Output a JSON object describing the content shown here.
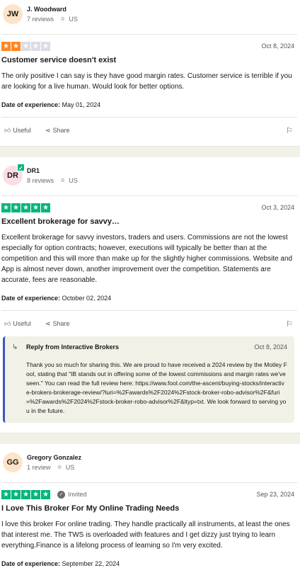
{
  "colors": {
    "star_green": "#00b67a",
    "star_orange": "#ff8622",
    "star_empty": "#dcdce6",
    "reply_accent": "#3c57bc"
  },
  "reviews": [
    {
      "initials": "JW",
      "avatar_bg": "#fde4c8",
      "verified": false,
      "name": "J. Woodward",
      "reviews_count": "7 reviews",
      "country": "US",
      "rating": 2,
      "invited": "",
      "date": "Oct 8, 2024",
      "title": "Customer service doesn't exist",
      "body": "The only positive I can say is they have good margin rates. Customer service is terrible if you are looking for a live human. Would look for better options.",
      "exp_label": "Date of experience:",
      "exp_date": "May 01, 2024",
      "useful": "Useful",
      "share": "Share"
    },
    {
      "initials": "DR",
      "avatar_bg": "#fbdde4",
      "verified": true,
      "name": "DR1",
      "reviews_count": "8 reviews",
      "country": "US",
      "rating": 5,
      "invited": "",
      "date": "Oct 3, 2024",
      "title": "Excellent brokerage for savvy…",
      "body": "Excellent brokerage for savvy investors, traders and users. Commissions are not the lowest especially for option contracts; however, executions will typically be better than at the competition and this will more than make up for the slightly higher commissions. Website and App is almost never down, another improvement over the competition. Statements are accurate, fees are reasonable.",
      "exp_label": "Date of experience:",
      "exp_date": "October 02, 2024",
      "useful": "Useful",
      "share": "Share",
      "reply": {
        "from": "Reply from Interactive Brokers",
        "date": "Oct 8, 2024",
        "body": "Thank you so much for sharing this. We are proud to have received a 2024 review by the Motley Fool, stating that \"IB stands out in offering some of the lowest commissions and margin rates we've seen.\" You can read the full review here: https://www.fool.com/the-ascent/buying-stocks/interactive-brokers-brokerage-review/?luri=%2Fawards%2F2024%2Fstock-broker-robo-advisor%2F&furi=%2Fawards%2F2024%2Fstock-broker-robo-advisor%2F&ltyp=txt. We look forward to serving you in the future."
      }
    },
    {
      "initials": "GG",
      "avatar_bg": "#fde4c8",
      "verified": false,
      "name": "Gregory Gonzalez",
      "reviews_count": "1 review",
      "country": "US",
      "rating": 5,
      "invited": "Invited",
      "date": "Sep 23, 2024",
      "title": "I Love This Broker For My Online Trading Needs",
      "body": "I love this broker For online trading. They handle practically all instruments, at least the ones that interest me. The TWS is overloaded with features and I get dizzy just trying to learn everything.Finance is a lifelong process of learning so I'm very excited.",
      "exp_label": "Date of experience:",
      "exp_date": "September 22, 2024"
    }
  ]
}
